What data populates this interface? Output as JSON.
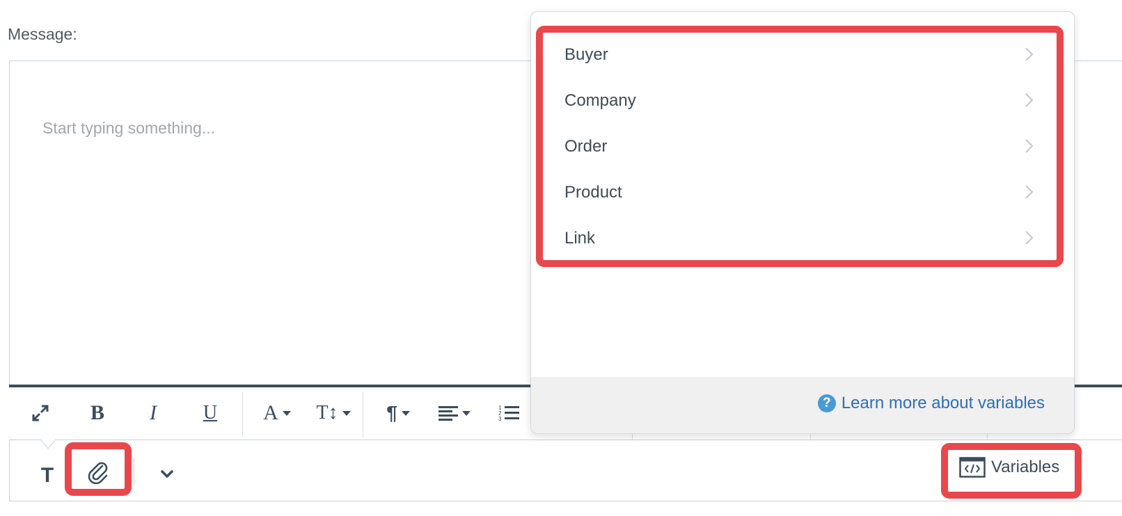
{
  "form": {
    "message_label": "Message:",
    "editor_placeholder": "Start typing something..."
  },
  "toolbar": {
    "buttons": [
      {
        "name": "expand",
        "icon": "expand-arrows-icon"
      },
      {
        "name": "bold",
        "label": "B"
      },
      {
        "name": "italic",
        "label": "I"
      },
      {
        "name": "underline",
        "label": "U"
      },
      {
        "name": "font-color",
        "label": "A"
      },
      {
        "name": "font-size",
        "label": "T↕"
      },
      {
        "name": "paragraph",
        "label": "¶"
      },
      {
        "name": "align",
        "icon": "align-left-icon"
      },
      {
        "name": "ordered-list",
        "icon": "ordered-list-icon"
      }
    ]
  },
  "bottom_bar": {
    "text_mode_label": "T",
    "attach_icon": "paperclip-icon",
    "more_icon": "chevron-down-icon",
    "variables_label": "Variables",
    "variables_icon": "code-window-icon"
  },
  "variables_menu": {
    "items": [
      {
        "label": "Buyer"
      },
      {
        "label": "Company"
      },
      {
        "label": "Order"
      },
      {
        "label": "Product"
      },
      {
        "label": "Link"
      }
    ],
    "footer_link": "Learn more about variables",
    "footer_icon": "question-circle-icon"
  },
  "colors": {
    "highlight": "#e8474c",
    "link": "#2f6eb5",
    "toolbar_border": "#3b4c5c"
  }
}
